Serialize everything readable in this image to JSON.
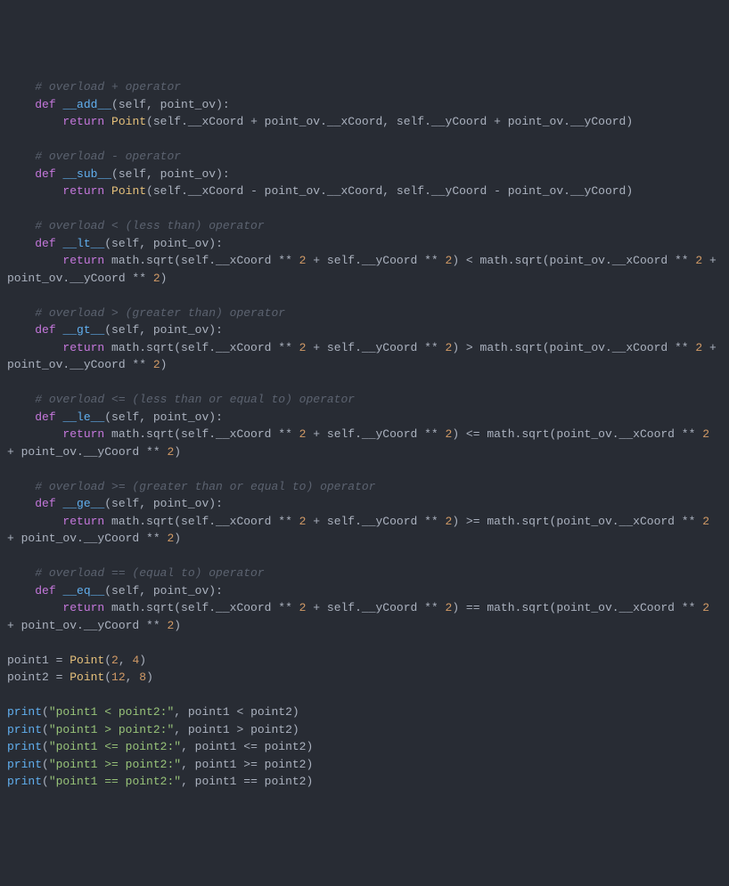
{
  "code": {
    "add_comment": "# overload + operator",
    "add_def": "__add__",
    "add_params": "(self, point_ov):",
    "add_return": "return",
    "add_body_pre": " Point(self.__xCoord + point_ov.__xCoord, self.__yCoord + point_ov.__yCoord)",
    "sub_comment": "# overload - operator",
    "sub_def": "__sub__",
    "sub_params": "(self, point_ov):",
    "sub_return": "return",
    "sub_body_pre": " Point(self.__xCoord - point_ov.__xCoord, self.__yCoord - point_ov.__yCoord)",
    "lt_comment": "# overload < (less than) operator",
    "lt_def": "__lt__",
    "lt_params": "(self, point_ov):",
    "lt_return": "return",
    "lt_body": " math.sqrt(self.__xCoord ** 2 + self.__yCoord ** 2) < math.sqrt(point_ov.__xCoord ** 2 + point_ov.__yCoord ** 2)",
    "gt_comment": "# overload > (greater than) operator",
    "gt_def": "__gt__",
    "gt_params": "(self, point_ov):",
    "gt_return": "return",
    "gt_body": " math.sqrt(self.__xCoord ** 2 + self.__yCoord ** 2) > math.sqrt(point_ov.__xCoord ** 2 + point_ov.__yCoord ** 2)",
    "le_comment": "# overload <= (less than or equal to) operator",
    "le_def": "__le__",
    "le_params": "(self, point_ov):",
    "le_return": "return",
    "le_body": " math.sqrt(self.__xCoord ** 2 + self.__yCoord ** 2) <= math.sqrt(point_ov.__xCoord ** 2 + point_ov.__yCoord ** 2)",
    "ge_comment": "# overload >= (greater than or equal to) operator",
    "ge_def": "__ge__",
    "ge_params": "(self, point_ov):",
    "ge_return": "return",
    "ge_body": " math.sqrt(self.__xCoord ** 2 + self.__yCoord ** 2) >= math.sqrt(point_ov.__xCoord ** 2 + point_ov.__yCoord ** 2)",
    "eq_comment": "# overload == (equal to) operator",
    "eq_def": "__eq__",
    "eq_params": "(self, point_ov):",
    "eq_return": "return",
    "eq_body": " math.sqrt(self.__xCoord ** 2 + self.__yCoord ** 2) == math.sqrt(point_ov.__xCoord ** 2 + point_ov.__yCoord ** 2)",
    "point1_assign": "point1 = Point(",
    "point1_n1": "2",
    "point1_mid": ", ",
    "point1_n2": "4",
    "point1_end": ")",
    "point2_assign": "point2 = Point(",
    "point2_n1": "12",
    "point2_mid": ", ",
    "point2_n2": "8",
    "point2_end": ")",
    "print1_call": "print",
    "print1_open": "(",
    "print1_str": "\"point1 < point2:\"",
    "print1_rest": ", point1 < point2)",
    "print2_str": "\"point1 > point2:\"",
    "print2_rest": ", point1 > point2)",
    "print3_str": "\"point1 <= point2:\"",
    "print3_rest": ", point1 <= point2)",
    "print4_str": "\"point1 >= point2:\"",
    "print4_rest": ", point1 >= point2)",
    "print5_str": "\"point1 == point2:\"",
    "print5_rest": ", point1 == point2)",
    "def_kw": "def",
    "indent4": "    ",
    "indent8": "        "
  }
}
